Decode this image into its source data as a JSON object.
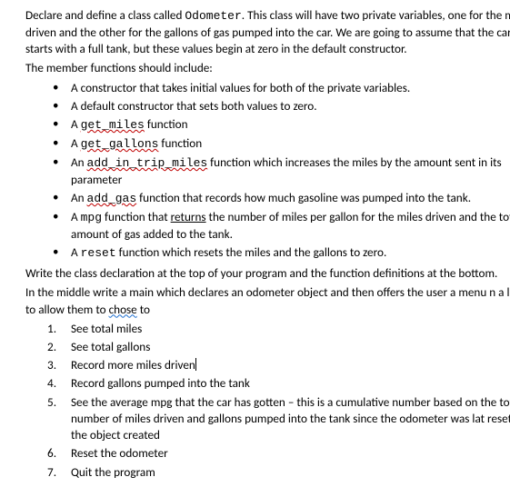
{
  "intro": {
    "p1_a": "Declare and define a class called ",
    "p1_code": "Odometer",
    "p1_b": ". This class will have two private variables, one for the miles driven and the other for the gallons of gas pumped into the car. We are going to assume that the car starts with a full tank, but these values begin at zero in the default constructor.",
    "p2": "The member functions should include:"
  },
  "members": [
    {
      "frags": [
        {
          "t": "A constructor that takes initial values for both of the private variables."
        }
      ]
    },
    {
      "frags": [
        {
          "t": "A default constructor that sets both values to zero."
        }
      ]
    },
    {
      "frags": [
        {
          "t": "A "
        },
        {
          "t": "get_miles",
          "cls": "code err-red"
        },
        {
          "t": " function"
        }
      ]
    },
    {
      "frags": [
        {
          "t": "A "
        },
        {
          "t": "get_gallons",
          "cls": "code err-red"
        },
        {
          "t": " function"
        }
      ]
    },
    {
      "frags": [
        {
          "t": "An "
        },
        {
          "t": "add_in_trip_miles",
          "cls": "code err-red"
        },
        {
          "t": " function which increases the miles by the amount sent in its parameter"
        }
      ]
    },
    {
      "frags": [
        {
          "t": "An "
        },
        {
          "t": "add_gas",
          "cls": "code err-red"
        },
        {
          "t": " function that records how much gasoline was pumped into the tank."
        }
      ]
    },
    {
      "frags": [
        {
          "t": "A "
        },
        {
          "t": "mpg",
          "cls": "code"
        },
        {
          "t": " function that "
        },
        {
          "t": "returns",
          "cls": "plain-u"
        },
        {
          "t": " the number of miles per gallon for the miles driven and the total amount of gas added to the tank."
        }
      ]
    },
    {
      "frags": [
        {
          "t": "A "
        },
        {
          "t": "reset",
          "cls": "code"
        },
        {
          "t": " function which resets the miles and the gallons to zero."
        }
      ]
    }
  ],
  "after_members": {
    "p1": "Write the class declaration at the top of your program and the function definitions at the bottom.",
    "p2_a": "In the middle write a main which declares an odometer object and then offers the user a menu n a loop to allow them to ",
    "p2_err": "chose",
    "p2_b": " to"
  },
  "menu": [
    {
      "frags": [
        {
          "t": "See total miles"
        }
      ]
    },
    {
      "frags": [
        {
          "t": "See total gallons"
        }
      ]
    },
    {
      "frags": [
        {
          "t": "Record more miles driven"
        }
      ],
      "cursor": true
    },
    {
      "frags": [
        {
          "t": "Record gallons pumped into the tank"
        }
      ]
    },
    {
      "frags": [
        {
          "t": "See the average mpg that the car has gotten – this is a cumulative number based on the total number of miles driven and gallons pumped into the tank since the odometer was lat reset, or the object created"
        }
      ]
    },
    {
      "frags": [
        {
          "t": "Reset the odometer"
        }
      ]
    },
    {
      "frags": [
        {
          "t": "Quit the program"
        }
      ]
    }
  ]
}
